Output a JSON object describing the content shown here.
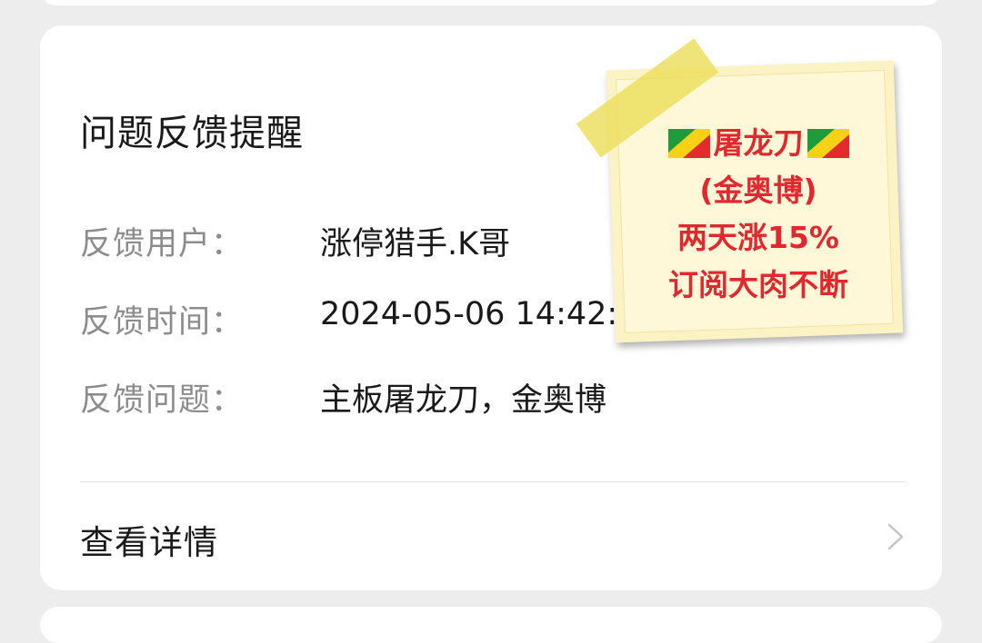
{
  "card": {
    "title": "问题反馈提醒",
    "rows": [
      {
        "label": "反馈用户：",
        "value": "涨停猎手.K哥"
      },
      {
        "label": "反馈时间：",
        "value": "2024-05-06 14:42:58"
      },
      {
        "label": "反馈问题：",
        "value": "主板屠龙刀，金奥博"
      }
    ],
    "detail_link": "查看详情"
  },
  "sticky_note": {
    "line1": "屠龙刀",
    "line2": "(金奥博)",
    "line3": "两天涨15%",
    "line4": "订阅大肉不断",
    "flag_icon": "congo-flag-icon",
    "text_color": "#e0282f"
  },
  "colors": {
    "background": "#ededed",
    "card": "#ffffff",
    "label_gray": "#8c8c8c",
    "text_dark": "#1a1a1a"
  }
}
